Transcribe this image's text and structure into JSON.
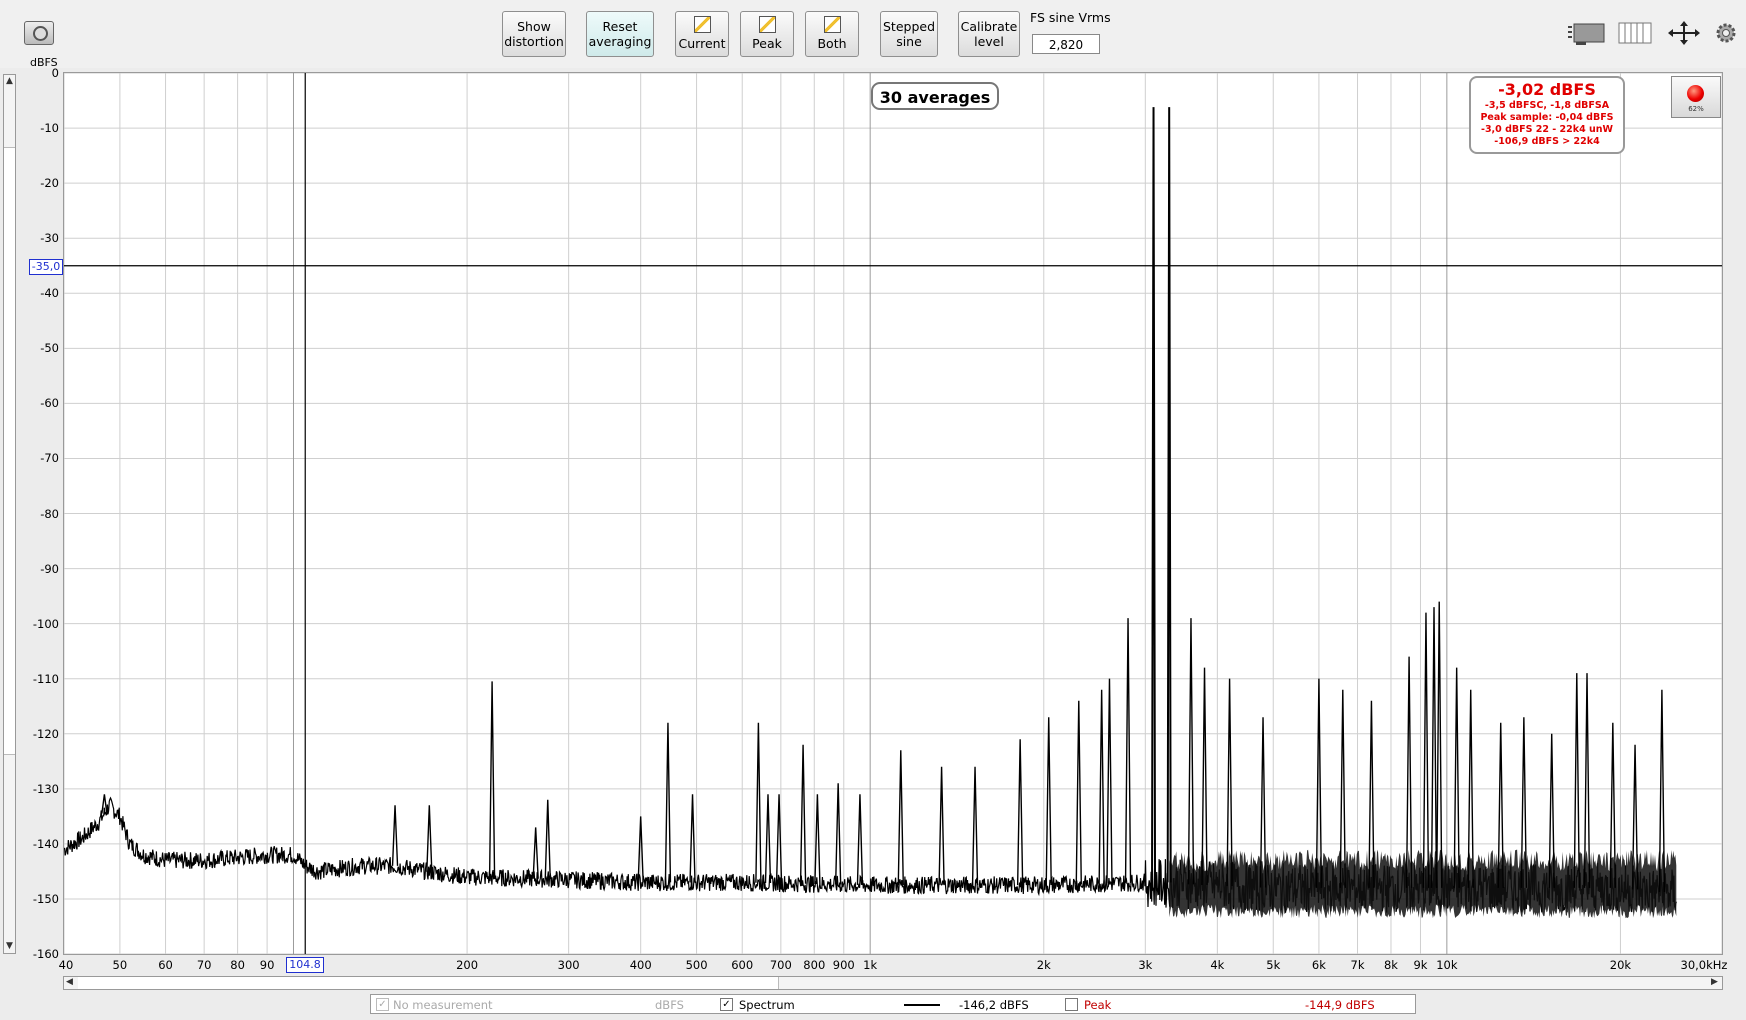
{
  "toolbar": {
    "buttons": [
      {
        "label1": "Show",
        "label2": "distortion"
      },
      {
        "label1": "Reset",
        "label2": "averaging"
      },
      {
        "label1": "Current"
      },
      {
        "label1": "Peak"
      },
      {
        "label1": "Both"
      },
      {
        "label1": "Stepped",
        "label2": "sine"
      },
      {
        "label1": "Calibrate",
        "label2": "level"
      }
    ],
    "fs_label": "FS sine Vrms",
    "fs_value": "2,820"
  },
  "chart_data": {
    "type": "line",
    "ylabel": "dBFS",
    "xlabel": "",
    "x_scale": "log",
    "xlim": [
      40,
      30000
    ],
    "ylim": [
      -160,
      0
    ],
    "yticks": [
      "0",
      "-10",
      "-20",
      "-30",
      "-40",
      "-50",
      "-60",
      "-70",
      "-80",
      "-90",
      "-100",
      "-110",
      "-120",
      "-130",
      "-140",
      "-150",
      "-160"
    ],
    "xticks": [
      {
        "v": 40,
        "l": "40"
      },
      {
        "v": 50,
        "l": "50"
      },
      {
        "v": 60,
        "l": "60"
      },
      {
        "v": 70,
        "l": "70"
      },
      {
        "v": 80,
        "l": "80"
      },
      {
        "v": 90,
        "l": "90"
      },
      {
        "v": 200,
        "l": "200"
      },
      {
        "v": 300,
        "l": "300"
      },
      {
        "v": 400,
        "l": "400"
      },
      {
        "v": 500,
        "l": "500"
      },
      {
        "v": 600,
        "l": "600"
      },
      {
        "v": 700,
        "l": "700"
      },
      {
        "v": 800,
        "l": "800"
      },
      {
        "v": 900,
        "l": "900"
      },
      {
        "v": 1000,
        "l": "1k"
      },
      {
        "v": 2000,
        "l": "2k"
      },
      {
        "v": 3000,
        "l": "3k"
      },
      {
        "v": 4000,
        "l": "4k"
      },
      {
        "v": 5000,
        "l": "5k"
      },
      {
        "v": 6000,
        "l": "6k"
      },
      {
        "v": 7000,
        "l": "7k"
      },
      {
        "v": 8000,
        "l": "8k"
      },
      {
        "v": 9000,
        "l": "9k"
      },
      {
        "v": 10000,
        "l": "10k"
      },
      {
        "v": 20000,
        "l": "20k"
      },
      {
        "v": 30000,
        "l": "30,0kHz"
      }
    ],
    "cursor_x": {
      "v": 104.8,
      "label": "104.8"
    },
    "cursor_y": {
      "v": -35,
      "label": "-35,0"
    },
    "noise_floor": [
      [
        40,
        -141
      ],
      [
        43,
        -139
      ],
      [
        46,
        -136
      ],
      [
        48,
        -133
      ],
      [
        50,
        -135
      ],
      [
        52,
        -140
      ],
      [
        55,
        -142
      ],
      [
        60,
        -143
      ],
      [
        70,
        -143
      ],
      [
        80,
        -142.5
      ],
      [
        90,
        -142
      ],
      [
        100,
        -142
      ],
      [
        105,
        -144
      ],
      [
        110,
        -145
      ],
      [
        130,
        -144
      ],
      [
        150,
        -144
      ],
      [
        170,
        -145
      ],
      [
        200,
        -146
      ],
      [
        300,
        -146.5
      ],
      [
        400,
        -147
      ],
      [
        600,
        -147
      ],
      [
        1000,
        -147.5
      ],
      [
        2000,
        -147.5
      ],
      [
        3000,
        -147
      ],
      [
        5000,
        -148
      ],
      [
        10000,
        -148
      ],
      [
        20000,
        -148
      ],
      [
        25000,
        -149
      ]
    ],
    "tones": [
      {
        "f": 3100,
        "db": -6.2
      },
      {
        "f": 3300,
        "db": -6.2
      }
    ],
    "spurs": [
      [
        47,
        -131
      ],
      [
        150,
        -133
      ],
      [
        172,
        -133
      ],
      [
        221,
        -110.5
      ],
      [
        263,
        -137
      ],
      [
        276,
        -132
      ],
      [
        400,
        -135
      ],
      [
        446,
        -118
      ],
      [
        492,
        -131
      ],
      [
        640,
        -118
      ],
      [
        665,
        -131
      ],
      [
        695,
        -131
      ],
      [
        765,
        -122
      ],
      [
        810,
        -131
      ],
      [
        880,
        -129
      ],
      [
        960,
        -131
      ],
      [
        1130,
        -123
      ],
      [
        1330,
        -126
      ],
      [
        1520,
        -126
      ],
      [
        1820,
        -121
      ],
      [
        2040,
        -117
      ],
      [
        2300,
        -114
      ],
      [
        2520,
        -112
      ],
      [
        2600,
        -110
      ],
      [
        2800,
        -99
      ],
      [
        3600,
        -99
      ],
      [
        3800,
        -108
      ],
      [
        4200,
        -110
      ],
      [
        4800,
        -117
      ],
      [
        6000,
        -110
      ],
      [
        6600,
        -112
      ],
      [
        7400,
        -114
      ],
      [
        8600,
        -106
      ],
      [
        9200,
        -98
      ],
      [
        9500,
        -97
      ],
      [
        9700,
        -96
      ],
      [
        10400,
        -108
      ],
      [
        11000,
        -112
      ],
      [
        12400,
        -118
      ],
      [
        13600,
        -117
      ],
      [
        15200,
        -120
      ],
      [
        16800,
        -109
      ],
      [
        17500,
        -109
      ],
      [
        19400,
        -118
      ],
      [
        21200,
        -122
      ],
      [
        23600,
        -112
      ]
    ]
  },
  "overlays": {
    "averages": "30 averages",
    "level_main": "-3,02 dBFS",
    "level_lines": [
      "-3,5 dBFSC, -1,8 dBFSA",
      "Peak sample: -0,04 dBFS",
      "-3,0 dBFS 22 - 22k4 unW",
      "-106,9 dBFS > 22k4"
    ],
    "clip_percent": "62%"
  },
  "legend": {
    "no_measurement": "No measurement",
    "unit": "dBFS",
    "spectrum": "Spectrum",
    "spectrum_value": "-146,2 dBFS",
    "peak": "Peak",
    "peak_value": "-144,9 dBFS"
  },
  "colors": {
    "trace": "#000000",
    "grid": "#cfcfcf",
    "level_text": "#e00000",
    "cursor_label": "#2030d0"
  }
}
